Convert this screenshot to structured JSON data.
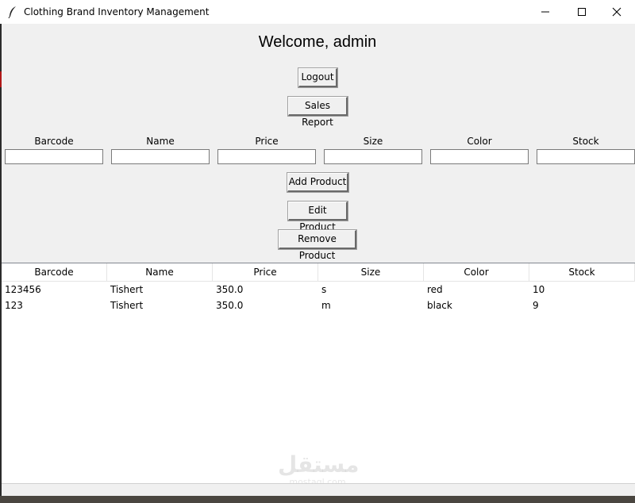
{
  "window": {
    "title": "Clothing Brand Inventory Management",
    "app_icon": "feather-icon"
  },
  "header": {
    "welcome": "Welcome, admin",
    "logout_label": "Logout",
    "sales_report_label": "Sales Report"
  },
  "form": {
    "fields": [
      {
        "label": "Barcode",
        "value": ""
      },
      {
        "label": "Name",
        "value": ""
      },
      {
        "label": "Price",
        "value": ""
      },
      {
        "label": "Size",
        "value": ""
      },
      {
        "label": "Color",
        "value": ""
      },
      {
        "label": "Stock",
        "value": ""
      }
    ],
    "add_label": "Add Product",
    "edit_label": "Edit Product",
    "remove_label": "Remove Product"
  },
  "table": {
    "columns": [
      "Barcode",
      "Name",
      "Price",
      "Size",
      "Color",
      "Stock"
    ],
    "rows": [
      [
        "123456",
        "Tishert",
        "350.0",
        "s",
        "red",
        "10"
      ],
      [
        "123",
        "Tishert",
        "350.0",
        "m",
        "black",
        "9"
      ]
    ]
  },
  "watermark": {
    "arabic": "مستقل",
    "latin": "mostaql.com"
  }
}
